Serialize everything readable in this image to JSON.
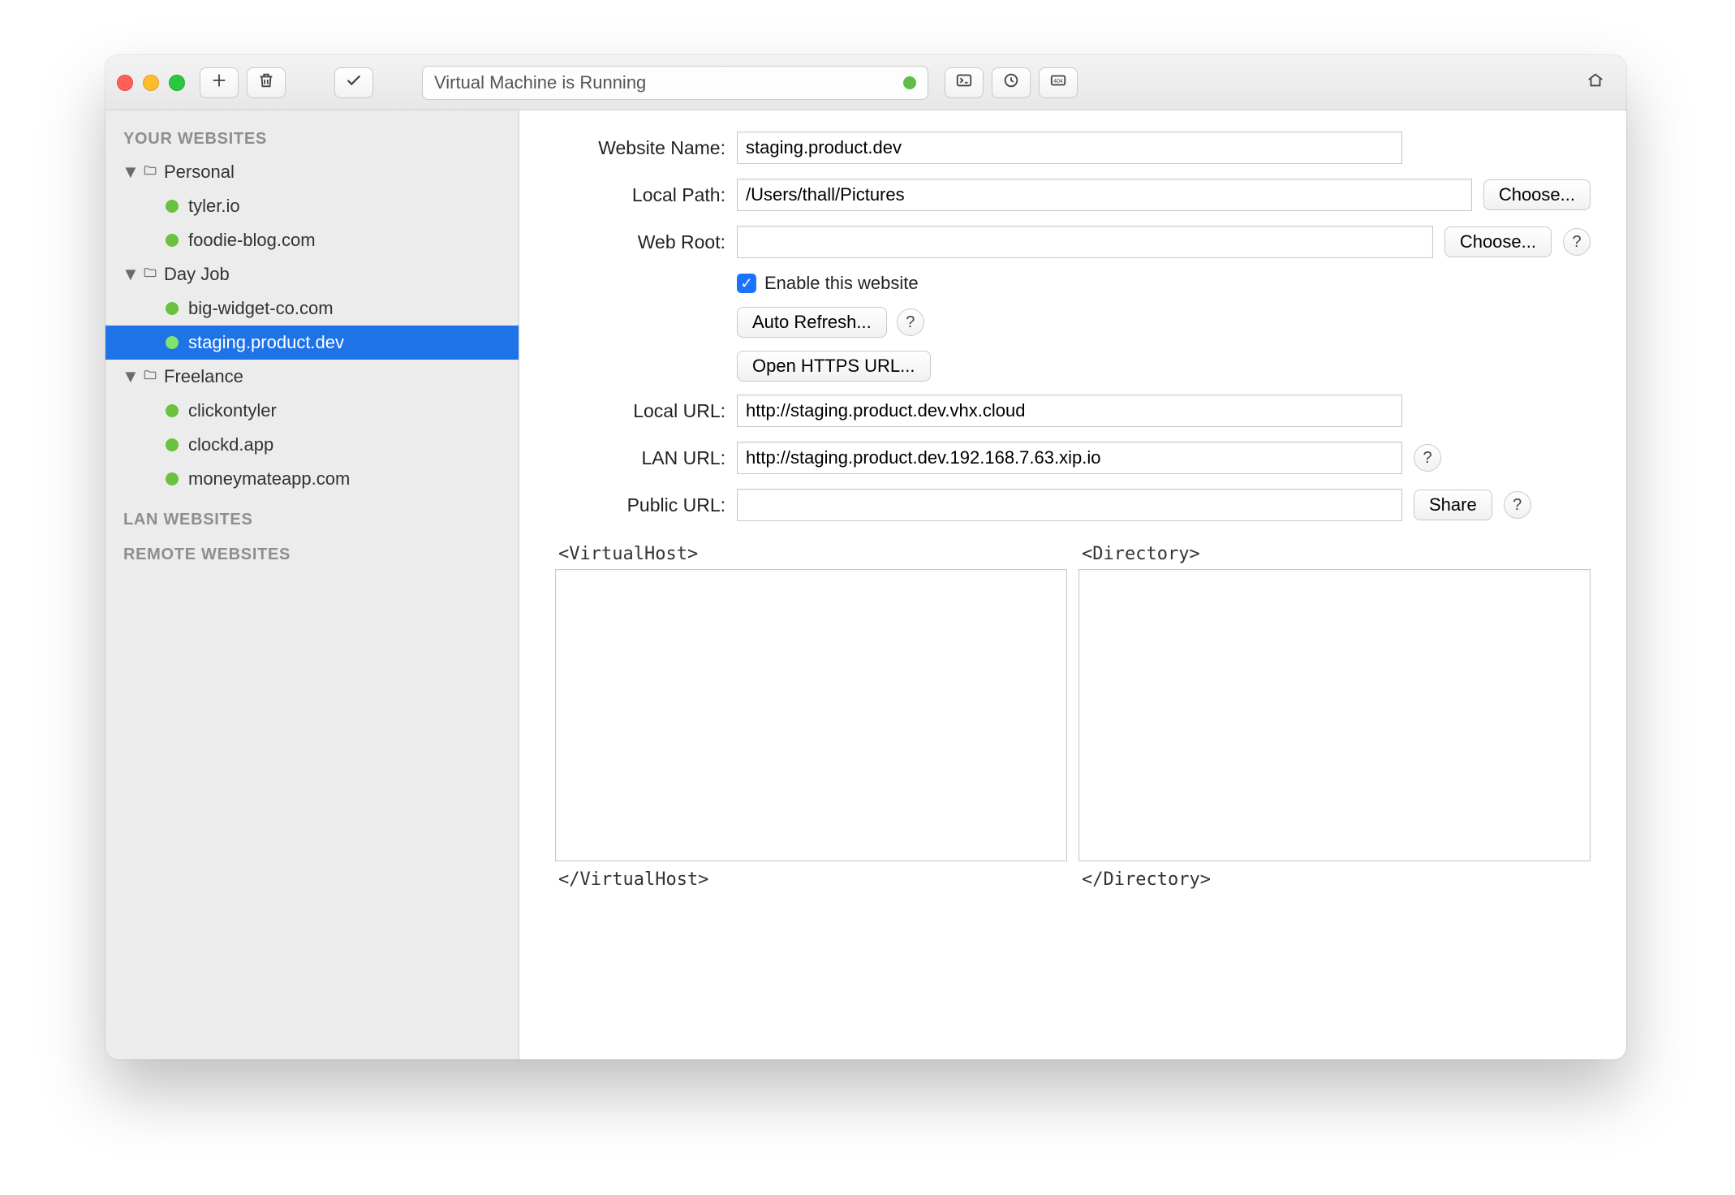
{
  "toolbar": {
    "status_text": "Virtual Machine is Running"
  },
  "sidebar": {
    "section_your_websites": "YOUR WEBSITES",
    "section_lan_websites": "LAN WEBSITES",
    "section_remote_websites": "REMOTE WEBSITES",
    "groups": [
      {
        "label": "Personal",
        "items": [
          "tyler.io",
          "foodie-blog.com"
        ]
      },
      {
        "label": "Day Job",
        "items": [
          "big-widget-co.com",
          "staging.product.dev"
        ]
      },
      {
        "label": "Freelance",
        "items": [
          "clickontyler",
          "clockd.app",
          "moneymateapp.com"
        ]
      }
    ],
    "selected": "staging.product.dev"
  },
  "form": {
    "labels": {
      "website_name": "Website Name:",
      "local_path": "Local Path:",
      "web_root": "Web Root:",
      "local_url": "Local URL:",
      "lan_url": "LAN URL:",
      "public_url": "Public URL:"
    },
    "values": {
      "website_name": "staging.product.dev",
      "local_path": "/Users/thall/Pictures",
      "web_root": "",
      "local_url": "http://staging.product.dev.vhx.cloud",
      "lan_url": "http://staging.product.dev.192.168.7.63.xip.io",
      "public_url": ""
    },
    "buttons": {
      "choose": "Choose...",
      "auto_refresh": "Auto Refresh...",
      "open_https": "Open HTTPS URL...",
      "share": "Share"
    },
    "checkbox": {
      "enable_label": "Enable this website",
      "enable_checked": true
    },
    "editors": {
      "vhost_open": "<VirtualHost>",
      "vhost_close": "</VirtualHost>",
      "dir_open": "<Directory>",
      "dir_close": "</Directory>"
    }
  }
}
